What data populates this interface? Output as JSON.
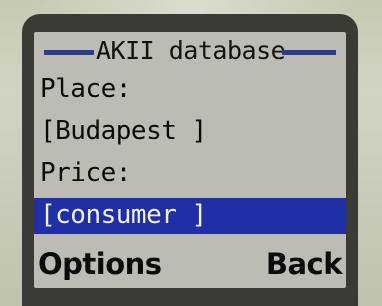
{
  "screen": {
    "title": "AKII database",
    "fields": [
      {
        "label": "Place:",
        "value": "[Budapest ]"
      },
      {
        "label": "Price:",
        "value": "[consumer ]"
      }
    ]
  },
  "softkeys": {
    "left": "Options",
    "right": "Back"
  },
  "colors": {
    "screen_bg": "#bcbcb4",
    "highlight": "#1f2fa7",
    "title_rule": "#2b3d8e",
    "phone_body": "#c6c9b2"
  }
}
